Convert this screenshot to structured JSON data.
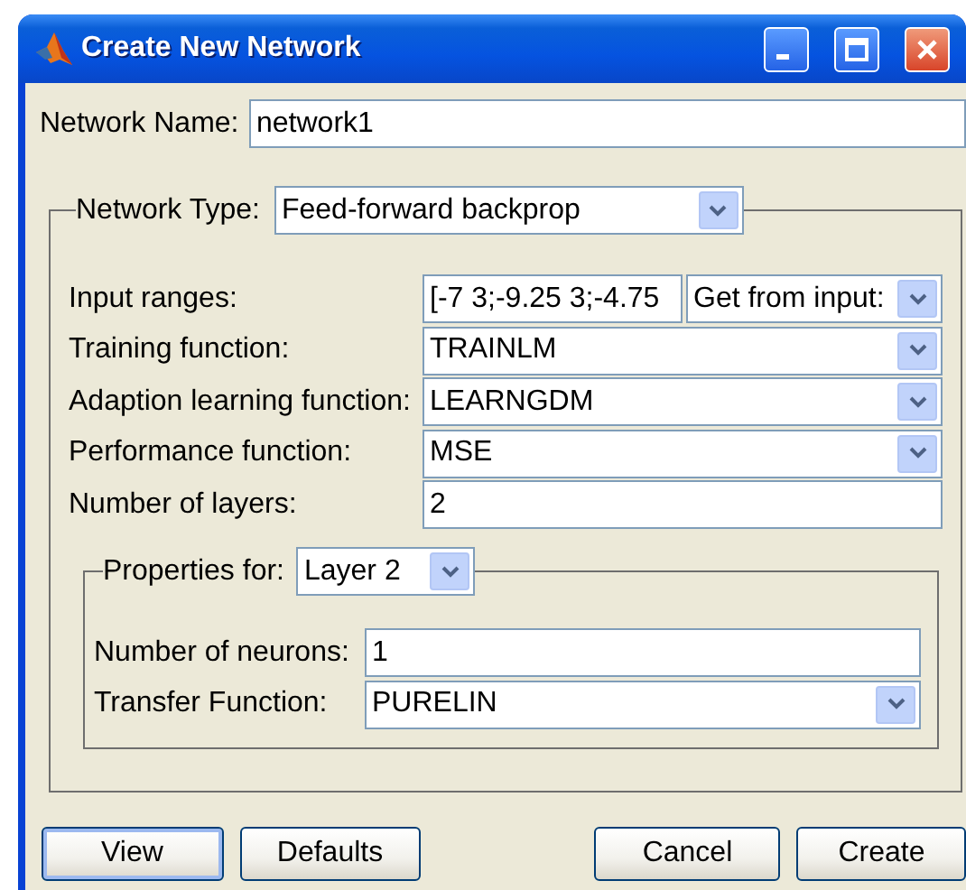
{
  "window": {
    "title": "Create New Network"
  },
  "network_name": {
    "label": "Network Name:",
    "value": "network1"
  },
  "network_type": {
    "label": "Network Type:",
    "value": "Feed-forward backprop"
  },
  "rows": [
    {
      "kind": "range",
      "label": "Input ranges:",
      "value": "[-7 3;-9.25 3;-4.75",
      "source": "Get from input:"
    },
    {
      "kind": "combo",
      "label": "Training function:",
      "value": "TRAINLM"
    },
    {
      "kind": "combo",
      "label": "Adaption learning function:",
      "value": "LEARNGDM"
    },
    {
      "kind": "combo",
      "label": "Performance function:",
      "value": "MSE"
    },
    {
      "kind": "field",
      "label": "Number of layers:",
      "value": "2"
    }
  ],
  "layer_properties": {
    "label": "Properties for:",
    "value": "Layer 2",
    "rows": [
      {
        "kind": "field",
        "label": "Number of neurons:",
        "value": "1"
      },
      {
        "kind": "combo",
        "label": "Transfer Function:",
        "value": "PURELIN"
      }
    ]
  },
  "buttons": [
    {
      "label": "View",
      "focused": true
    },
    {
      "label": "Defaults",
      "focused": false
    },
    {
      "label": "Cancel",
      "focused": false
    },
    {
      "label": "Create",
      "focused": false
    }
  ]
}
